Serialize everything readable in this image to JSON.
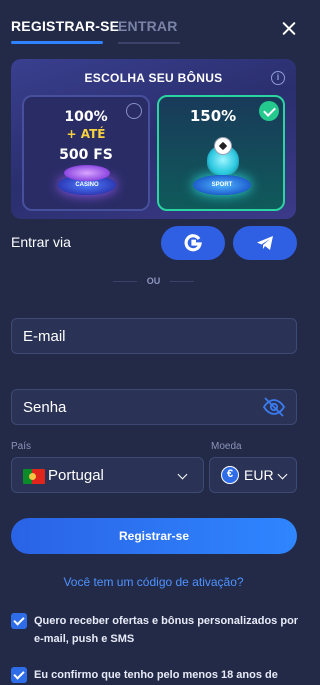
{
  "tabs": {
    "register_label": "REGISTRAR-SE",
    "login_label": "ENTRAR"
  },
  "bonus": {
    "title": "ESCOLHA SEU BÔNUS",
    "info_icon": "i",
    "casino": {
      "line1": "100%",
      "line2": "+ ATÉ",
      "line3": "500 FS",
      "pedestal_label": "CASINO",
      "selected": false
    },
    "sport": {
      "line1": "150%",
      "pedestal_label": "SPORT",
      "selected": true
    },
    "colors": {
      "selected_check": "#24c98e",
      "selected_border": "#2bd4a0"
    }
  },
  "login_via": {
    "label": "Entrar via",
    "buttons": [
      {
        "name": "google-icon"
      },
      {
        "name": "telegram-icon"
      }
    ]
  },
  "divider": {
    "label": "OU"
  },
  "form": {
    "email_placeholder": "E-mail",
    "password_placeholder": "Senha",
    "country_label": "País",
    "country_value": "Portugal",
    "currency_label": "Moeda",
    "currency_symbol": "€",
    "currency_value": "EUR"
  },
  "register_button": {
    "label": "Registrar-se"
  },
  "activation_link": {
    "label": "Você tem um código de ativação?"
  },
  "checkboxes": [
    {
      "label": "Quero receber ofertas e bônus personalizados por e-mail, push e SMS",
      "checked": true
    },
    {
      "label": "Eu confirmo que tenho pelo menos 18 anos de",
      "checked": true
    }
  ],
  "colors": {
    "background": "#222a48",
    "accent": "#2f83ff",
    "link": "#4f93ff"
  }
}
